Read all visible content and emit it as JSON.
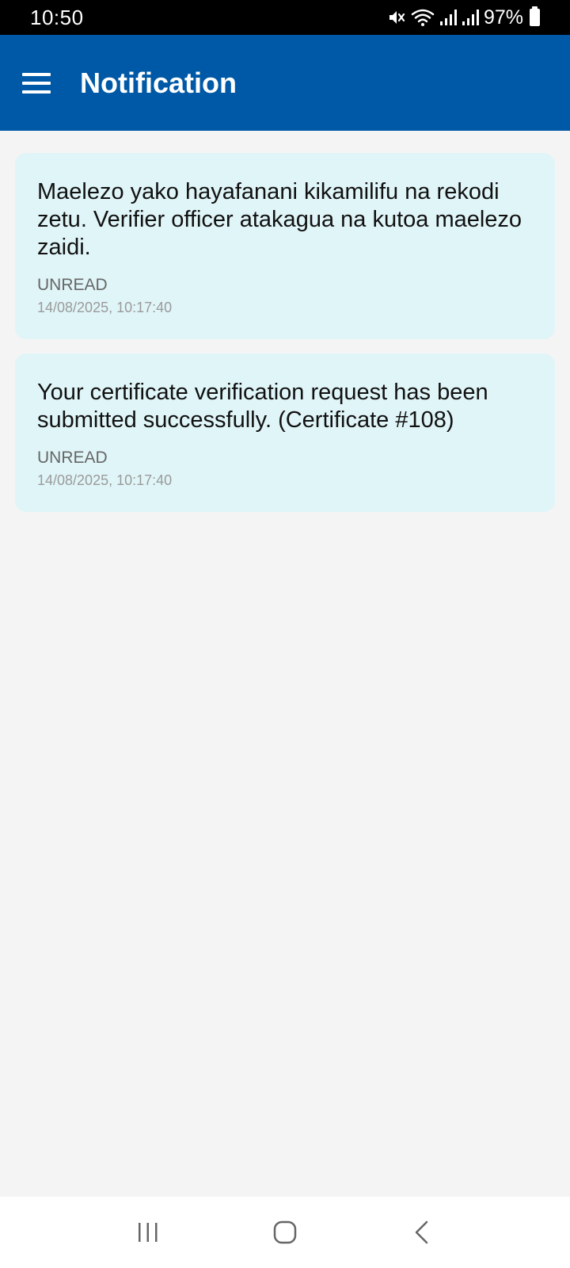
{
  "status_bar": {
    "time": "10:50",
    "battery": "97%",
    "icons": [
      "mute-icon",
      "wifi-icon",
      "signal-icon",
      "signal-icon",
      "battery-icon"
    ]
  },
  "app_bar": {
    "title": "Notification",
    "menu_icon": "hamburger-menu-icon",
    "color": "#0059a6"
  },
  "notifications": [
    {
      "message": "Maelezo yako hayafanani kikamilifu na rekodi zetu. Verifier officer atakagua na kutoa maelezo zaidi.",
      "status": "UNREAD",
      "timestamp": "14/08/2025, 10:17:40"
    },
    {
      "message": "Your certificate verification request has been submitted successfully. (Certificate #108)",
      "status": "UNREAD",
      "timestamp": "14/08/2025, 10:17:40"
    }
  ],
  "nav_bar": {
    "buttons": [
      "recent-apps-icon",
      "home-icon",
      "back-icon"
    ]
  }
}
